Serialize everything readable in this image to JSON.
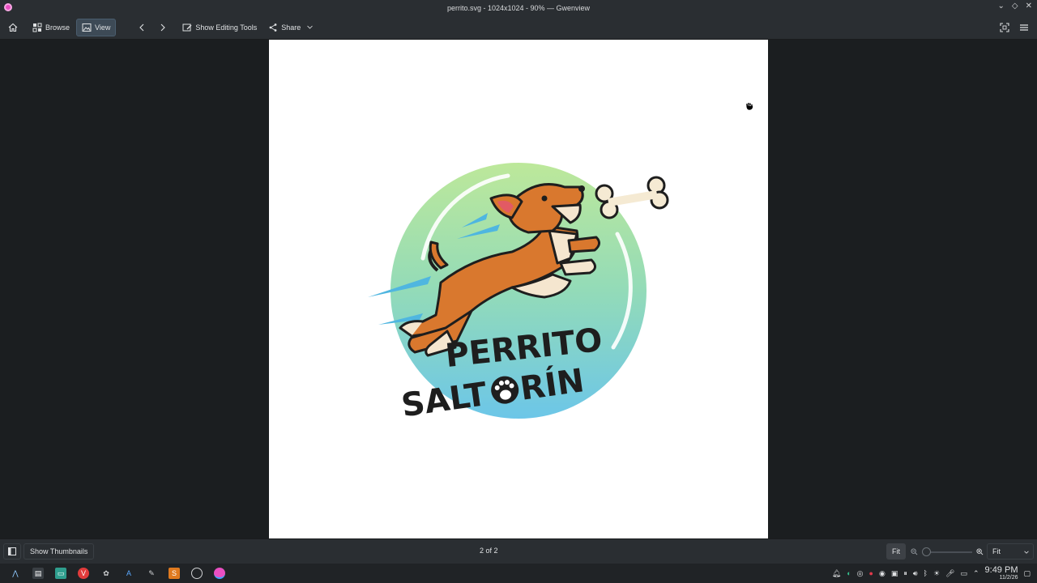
{
  "window": {
    "title": "perrito.svg - 1024x1024 - 90% — Gwenview"
  },
  "toolbar": {
    "browse_label": "Browse",
    "view_label": "View",
    "editing_label": "Show Editing Tools",
    "share_label": "Share"
  },
  "image": {
    "logo_line1": "PERRITO",
    "logo_line2_a": "SALT",
    "logo_line2_b": "RÍN"
  },
  "statusbar": {
    "thumbnails_label": "Show Thumbnails",
    "position": "2 of 2",
    "fit_button": "Fit",
    "zoom_select": "Fit"
  },
  "taskbar": {
    "time": "9:49 PM",
    "date": "11/2/26"
  },
  "colors": {
    "dog_orange": "#d9782e",
    "circle_top": "#b7e59a",
    "circle_bottom": "#6cc6e6",
    "accent_window": "#3d4a56"
  }
}
